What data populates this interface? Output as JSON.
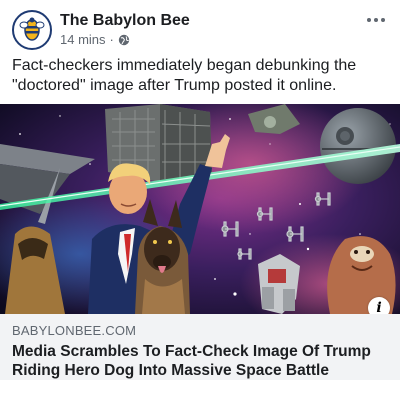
{
  "post": {
    "page_name": "The Babylon Bee",
    "time": "14 mins",
    "separator": "·",
    "privacy_icon": "globe-icon",
    "text": "Fact-checkers immediately began debunking the \"doctored\" image after Trump posted it online."
  },
  "link": {
    "domain": "BABYLONBEE.COM",
    "title": "Media Scrambles To Fact-Check Image Of Trump Riding Hero Dog Into Massive Space Battle",
    "info_icon": "info-icon",
    "info_glyph": "i"
  },
  "colors": {
    "accent": "#1f3b73",
    "bee_yellow": "#f4b41a",
    "preview_bg": "#f2f3f5",
    "laser_green": "#38f5a0"
  }
}
